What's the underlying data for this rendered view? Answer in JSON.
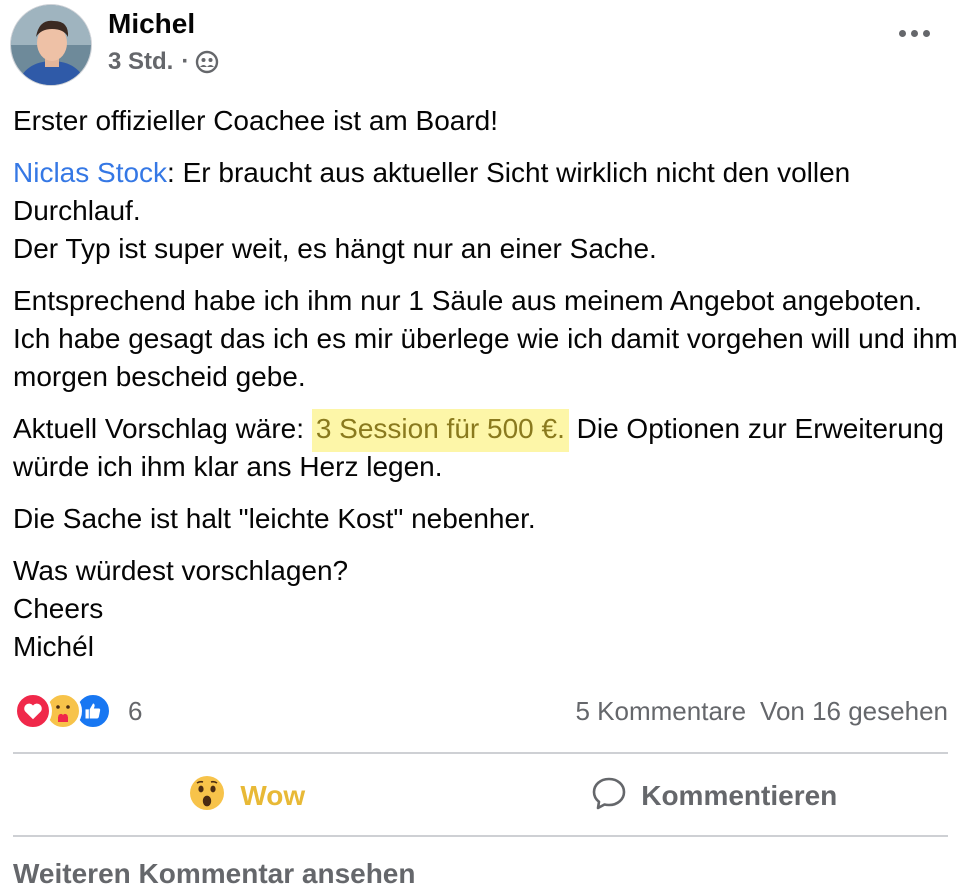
{
  "post": {
    "author": "Michel",
    "time": "3 Std.",
    "separator": "·",
    "privacy_icon": "friends-icon",
    "more_icon": "more-options-icon",
    "body": {
      "p1": "Erster offizieller Coachee ist am Board!",
      "mention": "Niclas Stock",
      "p2_after_mention": ": Er braucht aus aktueller Sicht wirklich nicht den vollen Durchlauf.",
      "p2_line2": "Der Typ ist super weit, es hängt nur an einer Sache.",
      "p3": "Entsprechend habe ich ihm nur 1 Säule aus meinem Angebot angeboten. Ich habe gesagt das ich es mir überlege wie ich damit vorgehen will und ihm morgen bescheid gebe.",
      "p4_before": "Aktuell Vorschlag wäre: ",
      "p4_highlight": "3 Session für 500 €.",
      "p4_after": " Die Optionen zur Erweiterung würde ich ihm klar ans Herz legen.",
      "p5": "Die Sache ist halt \"leichte Kost\" nebenher.",
      "p6_line1": "Was würdest vorschlagen?",
      "p6_line2": "Cheers",
      "p6_line3": "Michél"
    },
    "highlight_color": "#fdf6a8"
  },
  "reactions": {
    "icons": [
      "love-reaction-icon",
      "care-reaction-icon",
      "like-reaction-icon"
    ],
    "count": "6",
    "comments": "5 Kommentare",
    "seen": "Von 16 gesehen"
  },
  "actions": {
    "wow_label": "Wow",
    "comment_label": "Kommentieren",
    "wow_color": "#e8b936"
  },
  "footer": {
    "more_comments": "Weiteren Kommentar ansehen"
  }
}
